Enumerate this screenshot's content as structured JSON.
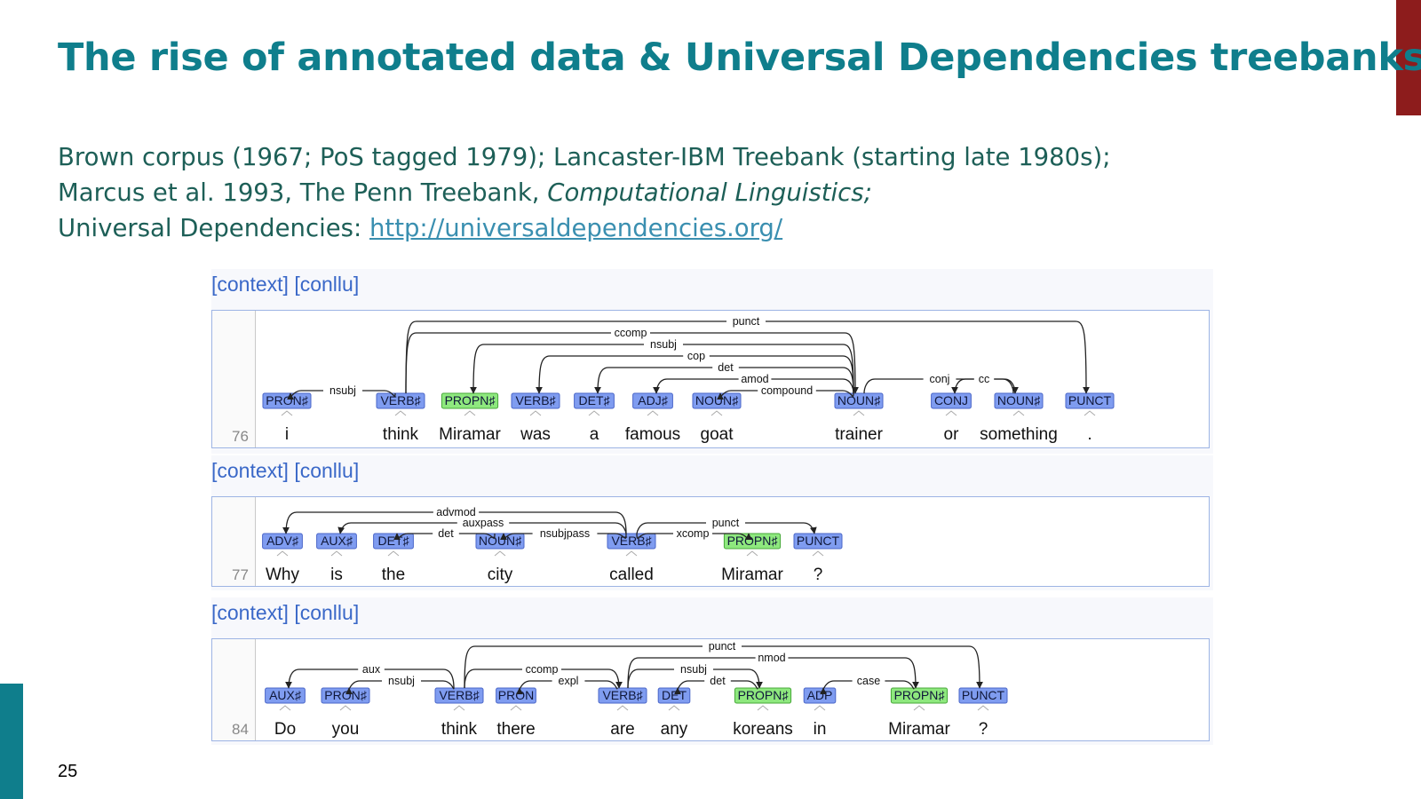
{
  "slide": {
    "title": "The rise of annotated data & Universal Dependencies treebanks",
    "lines": [
      "Brown corpus (1967; PoS tagged 1979); Lancaster-IBM Treebank (starting late 1980s);",
      "Marcus et al. 1993, The Penn Treebank, ",
      "Universal Dependencies: "
    ],
    "journal": "Computational Linguistics;",
    "link": "http://universaldependencies.org/",
    "page_number": "25",
    "colors": {
      "title": "#0f7e8c",
      "body": "#1d5f57",
      "accent_top": "#8d1c1c",
      "accent_left": "#0f7e8c",
      "link": "#3a8fb0"
    }
  },
  "sentences": [
    {
      "id": "76",
      "context_label": "[context]",
      "conllu_label": "[conllu]",
      "tokens": [
        {
          "word": "i",
          "pos": "PRON",
          "feat": true
        },
        {
          "word": "think",
          "pos": "VERB",
          "feat": true
        },
        {
          "word": "Miramar",
          "pos": "PROPN",
          "feat": true
        },
        {
          "word": "was",
          "pos": "VERB",
          "feat": true
        },
        {
          "word": "a",
          "pos": "DET",
          "feat": true
        },
        {
          "word": "famous",
          "pos": "ADJ",
          "feat": true
        },
        {
          "word": "goat",
          "pos": "NOUN",
          "feat": true
        },
        {
          "word": "trainer",
          "pos": "NOUN",
          "feat": true
        },
        {
          "word": "or",
          "pos": "CONJ",
          "feat": false
        },
        {
          "word": "something",
          "pos": "NOUN",
          "feat": true
        },
        {
          "word": ".",
          "pos": "PUNCT",
          "feat": false
        }
      ],
      "arcs": [
        {
          "from": 2,
          "to": 11,
          "label": "punct"
        },
        {
          "from": 2,
          "to": 8,
          "label": "ccomp"
        },
        {
          "from": 8,
          "to": 3,
          "label": "nsubj"
        },
        {
          "from": 8,
          "to": 4,
          "label": "cop"
        },
        {
          "from": 8,
          "to": 5,
          "label": "det"
        },
        {
          "from": 8,
          "to": 6,
          "label": "amod"
        },
        {
          "from": 8,
          "to": 7,
          "label": "compound"
        },
        {
          "from": 8,
          "to": 10,
          "label": "conj"
        },
        {
          "from": 10,
          "to": 9,
          "label": "cc"
        },
        {
          "from": 2,
          "to": 1,
          "label": "nsubj"
        }
      ]
    },
    {
      "id": "77",
      "context_label": "[context]",
      "conllu_label": "[conllu]",
      "tokens": [
        {
          "word": "Why",
          "pos": "ADV",
          "feat": true
        },
        {
          "word": "is",
          "pos": "AUX",
          "feat": true
        },
        {
          "word": "the",
          "pos": "DET",
          "feat": true
        },
        {
          "word": "city",
          "pos": "NOUN",
          "feat": true
        },
        {
          "word": "called",
          "pos": "VERB",
          "feat": true
        },
        {
          "word": "Miramar",
          "pos": "PROPN",
          "feat": true
        },
        {
          "word": "?",
          "pos": "PUNCT",
          "feat": false
        }
      ],
      "arcs": [
        {
          "from": 5,
          "to": 1,
          "label": "advmod"
        },
        {
          "from": 5,
          "to": 2,
          "label": "auxpass"
        },
        {
          "from": 4,
          "to": 3,
          "label": "det"
        },
        {
          "from": 5,
          "to": 4,
          "label": "nsubjpass"
        },
        {
          "from": 5,
          "to": 7,
          "label": "punct"
        },
        {
          "from": 5,
          "to": 6,
          "label": "xcomp"
        }
      ]
    },
    {
      "id": "84",
      "context_label": "[context]",
      "conllu_label": "[conllu]",
      "tokens": [
        {
          "word": "Do",
          "pos": "AUX",
          "feat": true
        },
        {
          "word": "you",
          "pos": "PRON",
          "feat": true
        },
        {
          "word": "think",
          "pos": "VERB",
          "feat": true
        },
        {
          "word": "there",
          "pos": "PRON",
          "feat": false
        },
        {
          "word": "are",
          "pos": "VERB",
          "feat": true
        },
        {
          "word": "any",
          "pos": "DET",
          "feat": false
        },
        {
          "word": "koreans",
          "pos": "PROPN",
          "feat": true
        },
        {
          "word": "in",
          "pos": "ADP",
          "feat": false
        },
        {
          "word": "Miramar",
          "pos": "PROPN",
          "feat": true
        },
        {
          "word": "?",
          "pos": "PUNCT",
          "feat": false
        }
      ],
      "arcs": [
        {
          "from": 3,
          "to": 10,
          "label": "punct"
        },
        {
          "from": 5,
          "to": 9,
          "label": "nmod"
        },
        {
          "from": 3,
          "to": 1,
          "label": "aux"
        },
        {
          "from": 3,
          "to": 5,
          "label": "ccomp"
        },
        {
          "from": 5,
          "to": 7,
          "label": "nsubj"
        },
        {
          "from": 7,
          "to": 6,
          "label": "det"
        },
        {
          "from": 3,
          "to": 2,
          "label": "nsubj"
        },
        {
          "from": 5,
          "to": 4,
          "label": "expl"
        },
        {
          "from": 9,
          "to": 8,
          "label": "case"
        }
      ]
    }
  ]
}
